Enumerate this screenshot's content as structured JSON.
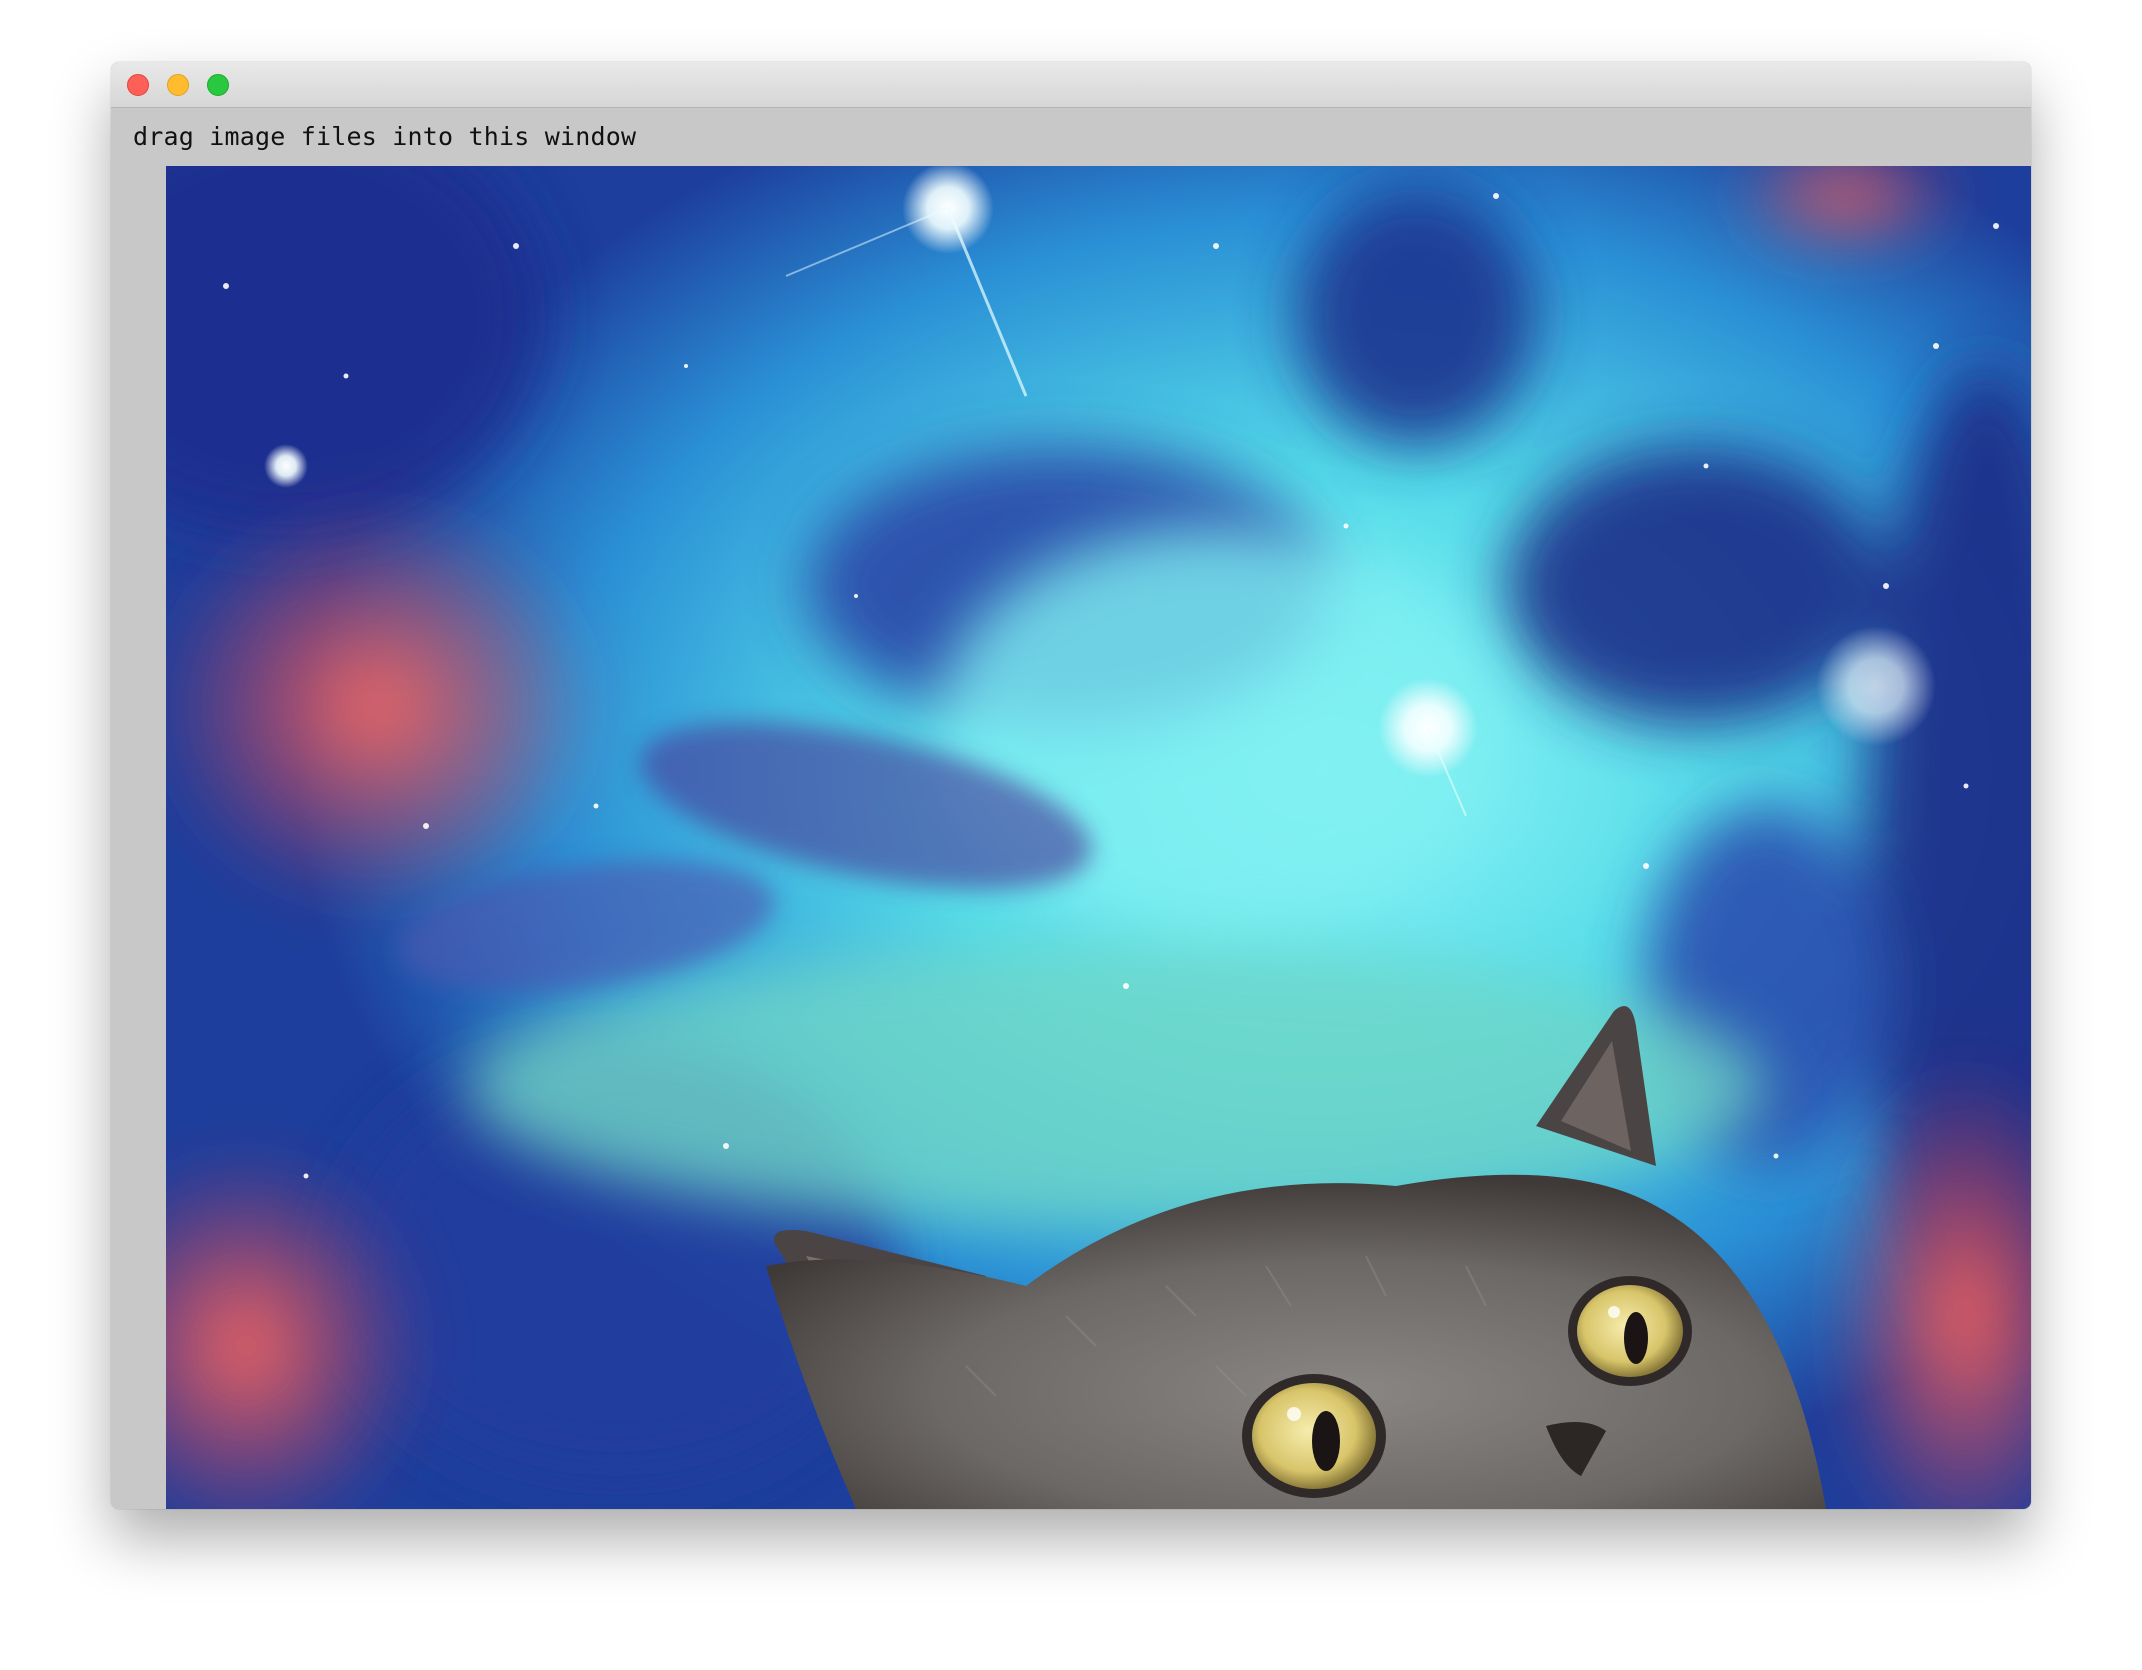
{
  "window": {
    "controls": {
      "close_icon": "close-icon",
      "minimize_icon": "minimize-icon",
      "zoom_icon": "zoom-icon",
      "colors": {
        "close": "#fe5f57",
        "minimize": "#febc2e",
        "zoom": "#28c840"
      }
    }
  },
  "content": {
    "hint_text": "drag image files into this window",
    "background_color": "#c8c8c8"
  },
  "image": {
    "subject": "cat peeking up in front of colorful space nebula",
    "palette": {
      "space_deep": "#1b2f8f",
      "space_cyan": "#5fe3ee",
      "nebula_red": "#e14a4a",
      "cat_fur": "#6f6c6a",
      "cat_eye": "#e8d98a"
    }
  }
}
